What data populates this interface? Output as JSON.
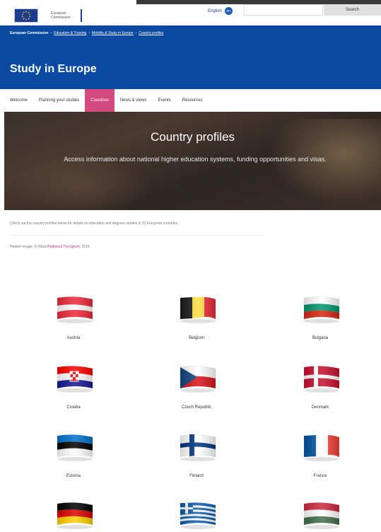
{
  "header": {
    "logo_text": "European Commission",
    "language": "English",
    "language_code": "en",
    "search_placeholder": "",
    "search_button": "Search"
  },
  "breadcrumb": [
    "European Commission",
    "Education & Training",
    "Mobility & Study in Europe",
    "Country profiles"
  ],
  "site_title": "Study in Europe",
  "nav": [
    "Welcome",
    "Planning your studies",
    "Countries",
    "News & views",
    "Events",
    "Resources"
  ],
  "nav_active": "Countries",
  "hero": {
    "title": "Country profiles",
    "description": "Access information about national higher education systems, funding opportunities and visas."
  },
  "intro_text": "Check out the country profiles below for details on education and degrees studies in 33 European countries.",
  "credit": {
    "prefix": "Header image: © iStock/",
    "link": "Nattawut Thongkum",
    "suffix": ", 2016"
  },
  "countries": [
    {
      "name": "Austria",
      "icon": "flag-austria-icon"
    },
    {
      "name": "Belgium",
      "icon": "flag-belgium-icon"
    },
    {
      "name": "Bulgaria",
      "icon": "flag-bulgaria-icon"
    },
    {
      "name": "Croatia",
      "icon": "flag-croatia-icon"
    },
    {
      "name": "Czech Republic",
      "icon": "flag-czech-republic-icon"
    },
    {
      "name": "Denmark",
      "icon": "flag-denmark-icon"
    },
    {
      "name": "Estonia",
      "icon": "flag-estonia-icon"
    },
    {
      "name": "Finland",
      "icon": "flag-finland-icon"
    },
    {
      "name": "France",
      "icon": "flag-france-icon"
    },
    {
      "name": "",
      "icon": "flag-germany-icon"
    },
    {
      "name": "",
      "icon": "flag-greece-icon"
    },
    {
      "name": "",
      "icon": "flag-hungary-icon"
    }
  ],
  "colors": {
    "banner": "#0b4aa3",
    "nav_active": "#d24a7e",
    "link": "#b23a78"
  }
}
